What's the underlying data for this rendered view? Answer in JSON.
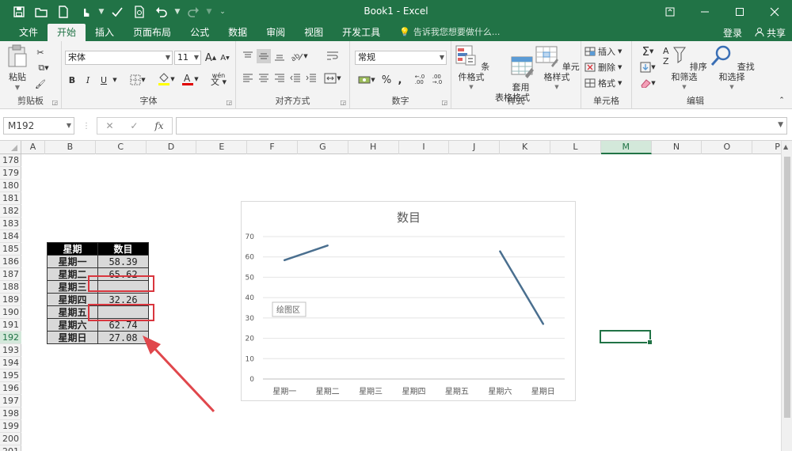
{
  "window": {
    "title": "Book1 - Excel"
  },
  "menu": {
    "tabs": [
      "文件",
      "开始",
      "插入",
      "页面布局",
      "公式",
      "数据",
      "审阅",
      "视图",
      "开发工具"
    ],
    "active_tab": "开始",
    "tell_me": "告诉我您想要做什么...",
    "login": "登录",
    "share": "共享"
  },
  "ribbon": {
    "clipboard": {
      "label": "剪贴板",
      "paste": "粘贴"
    },
    "font": {
      "label": "字体",
      "name": "宋体",
      "size": "11",
      "bold": "B",
      "italic": "I",
      "underline": "U",
      "grow": "A",
      "shrink": "A",
      "phonetic": "wén"
    },
    "alignment": {
      "label": "对齐方式"
    },
    "number": {
      "label": "数字",
      "format": "常规",
      "percent": "%",
      "comma": ",",
      "inc_dec": "←.0\n.00",
      "dec_dec": ".00\n→.0"
    },
    "styles": {
      "label": "样式",
      "conditional": "条件格式",
      "table": "套用\n表格格式",
      "cell": "单元格样式"
    },
    "cells": {
      "label": "单元格",
      "insert": "插入",
      "delete": "删除",
      "format": "格式"
    },
    "editing": {
      "label": "编辑",
      "sort": "排序和筛选",
      "find": "查找和选择"
    }
  },
  "formula_bar": {
    "name_box": "M192",
    "fx": "fx",
    "value": ""
  },
  "sheet": {
    "columns": [
      "A",
      "B",
      "C",
      "D",
      "E",
      "F",
      "G",
      "H",
      "I",
      "J",
      "K",
      "L",
      "M",
      "N",
      "O",
      "P"
    ],
    "selected_column": "M",
    "rows": [
      "178",
      "179",
      "180",
      "181",
      "182",
      "183",
      "184",
      "185",
      "186",
      "187",
      "188",
      "189",
      "190",
      "191",
      "192",
      "193",
      "194",
      "195",
      "196",
      "197",
      "198",
      "199",
      "200",
      "201"
    ],
    "selected_row": "192"
  },
  "table": {
    "headers": [
      "星期",
      "数目"
    ],
    "rows": [
      {
        "day": "星期一",
        "value": "58.39"
      },
      {
        "day": "星期二",
        "value": "65.62"
      },
      {
        "day": "星期三",
        "value": ""
      },
      {
        "day": "星期四",
        "value": "32.26"
      },
      {
        "day": "星期五",
        "value": ""
      },
      {
        "day": "星期六",
        "value": "62.74"
      },
      {
        "day": "星期日",
        "value": "27.08"
      }
    ]
  },
  "chart_tooltip": "绘图区",
  "colors": {
    "excel_green": "#217346",
    "highlight_red": "#d9363e",
    "series": "#4a6f8f",
    "arrow": "#e0474c"
  },
  "chart_data": {
    "type": "line",
    "title": "数目",
    "categories": [
      "星期一",
      "星期二",
      "星期三",
      "星期四",
      "星期五",
      "星期六",
      "星期日"
    ],
    "series": [
      {
        "values": [
          58.39,
          65.62,
          null,
          32.26,
          null,
          62.74,
          27.08
        ]
      }
    ],
    "ylim": [
      0,
      70
    ],
    "yticks": [
      0,
      10,
      20,
      30,
      40,
      50,
      60,
      70
    ],
    "grid": true,
    "xlabel": "",
    "ylabel": ""
  }
}
